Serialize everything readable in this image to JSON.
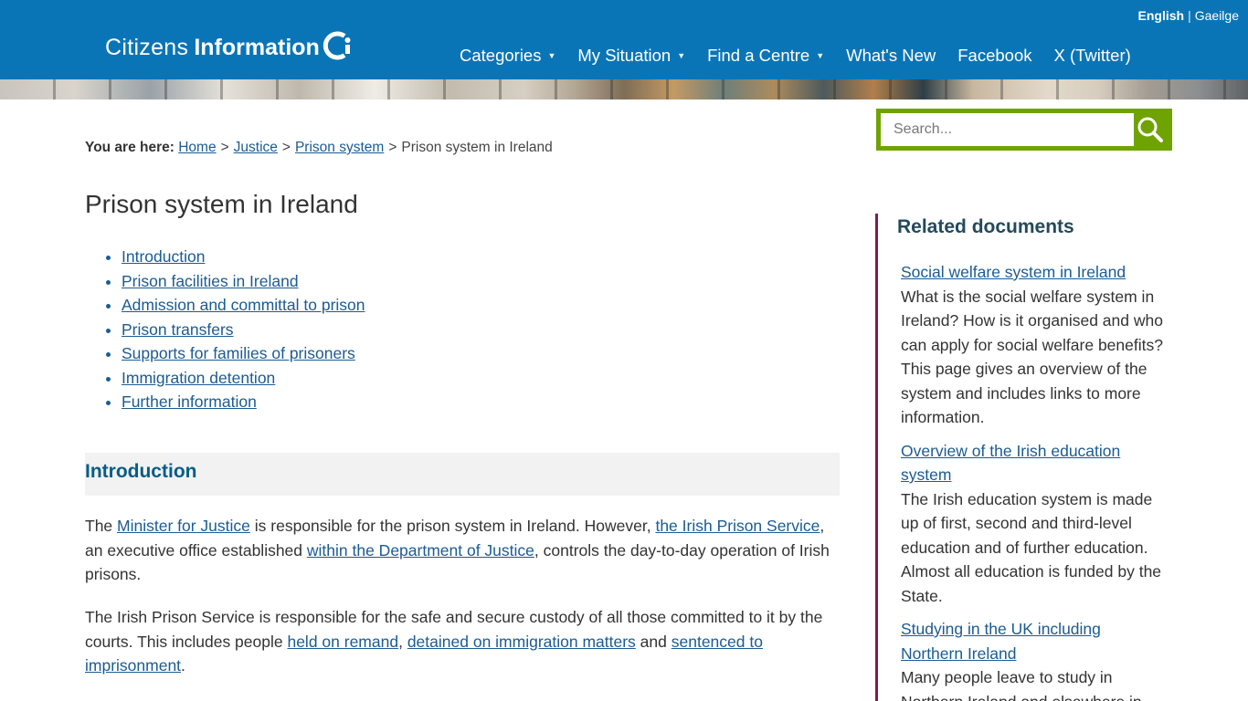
{
  "header": {
    "lang_current": "English",
    "lang_separator": "|",
    "lang_other": "Gaeilge",
    "logo_light": "Citizens",
    "logo_bold": "Information",
    "nav": [
      {
        "label": "Categories",
        "has_dropdown": true
      },
      {
        "label": "My Situation",
        "has_dropdown": true
      },
      {
        "label": "Find a Centre",
        "has_dropdown": true
      },
      {
        "label": "What's New",
        "has_dropdown": false
      },
      {
        "label": "Facebook",
        "has_dropdown": false
      },
      {
        "label": "X (Twitter)",
        "has_dropdown": false
      }
    ],
    "caret": "▼"
  },
  "search": {
    "placeholder": "Search...",
    "icon": "search-icon"
  },
  "breadcrumb": {
    "label": "You are here:",
    "items": [
      "Home",
      "Justice",
      "Prison system"
    ],
    "current": "Prison system in Ireland",
    "separator": ">"
  },
  "main": {
    "title": "Prison system in Ireland",
    "toc": [
      "Introduction",
      "Prison facilities in Ireland",
      "Admission and committal to prison",
      "Prison transfers",
      "Supports for families of prisoners",
      "Immigration detention",
      "Further information"
    ],
    "section_title": "Introduction",
    "p1": {
      "t1": "The ",
      "l1": "Minister for Justice",
      "t2": " is responsible for the prison system in Ireland. However, ",
      "l2": "the Irish Prison Service",
      "t3": ", an executive office established ",
      "l3": "within the Department of Justice",
      "t4": ", controls the day-to-day operation of Irish prisons."
    },
    "p2": {
      "t1": "The Irish Prison Service is responsible for the safe and secure custody of all those committed to it by the courts. This includes people ",
      "l1": "held on remand",
      "t2": ", ",
      "l2": "detained on immigration matters",
      "t3": " and ",
      "l3": "sentenced to imprisonment",
      "t4": "."
    }
  },
  "sidebar": {
    "title": "Related documents",
    "items": [
      {
        "link": "Social welfare system in Ireland",
        "desc": "What is the social welfare system in Ireland? How is it organised and who can apply for social welfare benefits? This page gives an overview of the system and includes links to more information."
      },
      {
        "link": "Overview of the Irish education system",
        "desc": "The Irish education system is made up of first, second and third-level education and of further education. Almost all education is funded by the State."
      },
      {
        "link": "Studying in the UK including Northern Ireland",
        "desc": "Many people leave to study in Northern Ireland and elsewhere in"
      }
    ]
  },
  "colors": {
    "header_bg": "#0a75b6",
    "search_border": "#6ea300",
    "link": "#1b5b93",
    "section_heading": "#075c87",
    "sidebar_border": "#7a1e53"
  }
}
